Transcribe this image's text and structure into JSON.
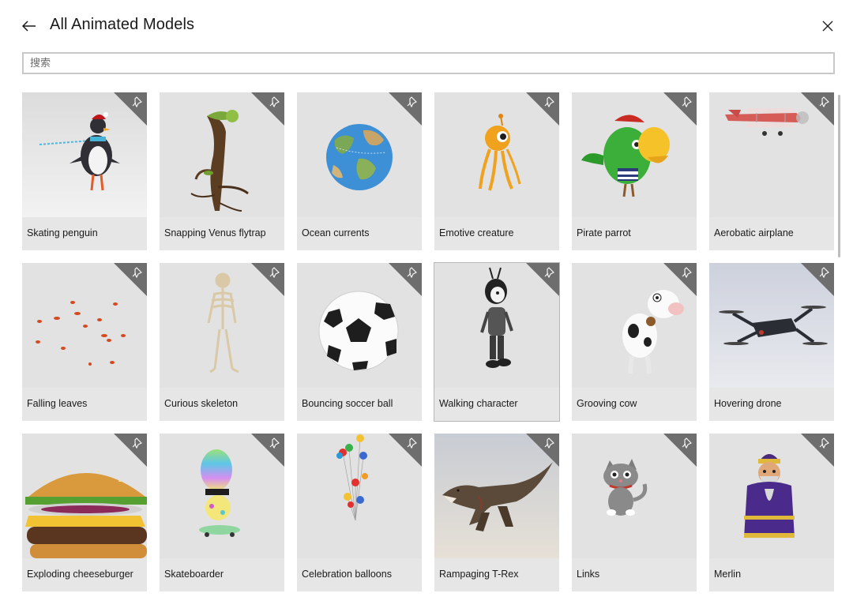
{
  "header": {
    "title": "All Animated Models",
    "back_icon": "back-arrow-icon",
    "close_icon": "close-icon"
  },
  "search": {
    "placeholder": "搜索",
    "value": ""
  },
  "grid": {
    "items": [
      {
        "label": "Skating penguin"
      },
      {
        "label": "Snapping Venus flytrap"
      },
      {
        "label": "Ocean currents"
      },
      {
        "label": "Emotive creature"
      },
      {
        "label": "Pirate parrot"
      },
      {
        "label": "Aerobatic airplane"
      },
      {
        "label": "Falling leaves"
      },
      {
        "label": "Curious skeleton"
      },
      {
        "label": "Bouncing soccer ball"
      },
      {
        "label": "Walking character"
      },
      {
        "label": "Grooving cow"
      },
      {
        "label": "Hovering drone"
      },
      {
        "label": "Exploding cheeseburger"
      },
      {
        "label": "Skateboarder"
      },
      {
        "label": "Celebration balloons"
      },
      {
        "label": "Rampaging T-Rex"
      },
      {
        "label": "Links"
      },
      {
        "label": "Merlin"
      }
    ],
    "badge_icon": "animation-icon"
  },
  "colors": {
    "card_bg": "#e6e6e6",
    "badge_bg": "#6e6e6e",
    "search_border": "#c8c8c8"
  }
}
